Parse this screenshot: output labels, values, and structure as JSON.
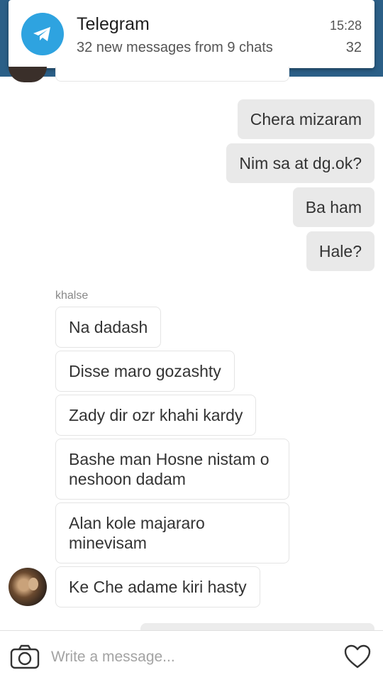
{
  "notification": {
    "app": "Telegram",
    "summary": "32 new messages from 9 chats",
    "time": "15:28",
    "count": "32",
    "icon": "telegram-icon"
  },
  "messages_outgoing": [
    "Chera mizaram",
    "Nim sa at dg.ok?",
    "Ba ham",
    "Hale?"
  ],
  "sender_name": "khalse",
  "messages_incoming": [
    "Na dadash",
    "Disse maro gozashty",
    "Zady dir ozr khahi kardy",
    "Bashe man Hosne nistam o neshoon dadam",
    "Alan kole majararo minevisam",
    "Ke Che adame kiri hasty"
  ],
  "composer": {
    "placeholder": "Write a message...",
    "camera_icon": "camera-icon",
    "like_icon": "heart-icon"
  },
  "colors": {
    "header": "#2b5f87",
    "telegram_blue": "#2ea3e0",
    "outgoing_bubble": "#e9e9e9",
    "incoming_border": "#e4e4e4"
  }
}
